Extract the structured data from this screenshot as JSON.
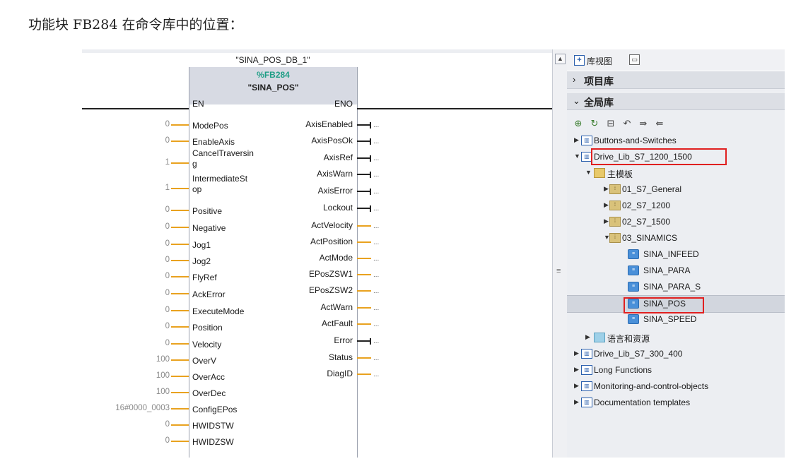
{
  "page_title": "功能块 FB284 在命令库中的位置：",
  "fb": {
    "db_name": "\"SINA_POS_DB_1\"",
    "number": "%FB284",
    "title": "\"SINA_POS\"",
    "inputs": [
      {
        "label": "EN",
        "value": ""
      },
      {
        "label": "ModePos",
        "value": "0"
      },
      {
        "label": "EnableAxis",
        "value": "0"
      },
      {
        "label": "CancelTraversin",
        "label2": "g",
        "value": "1"
      },
      {
        "label": "IntermediateSt",
        "label2": "op",
        "value": "1"
      },
      {
        "label": "Positive",
        "value": "0"
      },
      {
        "label": "Negative",
        "value": "0"
      },
      {
        "label": "Jog1",
        "value": "0"
      },
      {
        "label": "Jog2",
        "value": "0"
      },
      {
        "label": "FlyRef",
        "value": "0"
      },
      {
        "label": "AckError",
        "value": "0"
      },
      {
        "label": "ExecuteMode",
        "value": "0"
      },
      {
        "label": "Position",
        "value": "0"
      },
      {
        "label": "Velocity",
        "value": "0"
      },
      {
        "label": "OverV",
        "value": "100"
      },
      {
        "label": "OverAcc",
        "value": "100"
      },
      {
        "label": "OverDec",
        "value": "100"
      },
      {
        "label": "ConfigEPos",
        "value": "16#0000_0003"
      },
      {
        "label": "HWIDSTW",
        "value": "0"
      },
      {
        "label": "HWIDZSW",
        "value": "0"
      }
    ],
    "outputs": [
      {
        "label": "ENO",
        "kind": "rail"
      },
      {
        "label": "AxisEnabled",
        "kind": "bool"
      },
      {
        "label": "AxisPosOk",
        "kind": "bool"
      },
      {
        "label": "AxisRef",
        "kind": "bool"
      },
      {
        "label": "AxisWarn",
        "kind": "bool"
      },
      {
        "label": "AxisError",
        "kind": "bool"
      },
      {
        "label": "Lockout",
        "kind": "bool"
      },
      {
        "label": "ActVelocity",
        "kind": "word"
      },
      {
        "label": "ActPosition",
        "kind": "word"
      },
      {
        "label": "ActMode",
        "kind": "word"
      },
      {
        "label": "EPosZSW1",
        "kind": "word"
      },
      {
        "label": "EPosZSW2",
        "kind": "word"
      },
      {
        "label": "ActWarn",
        "kind": "word"
      },
      {
        "label": "ActFault",
        "kind": "word"
      },
      {
        "label": "Error",
        "kind": "bool"
      },
      {
        "label": "Status",
        "kind": "word"
      },
      {
        "label": "DiagID",
        "kind": "word"
      }
    ],
    "output_dots": "..."
  },
  "library": {
    "view_label": "库视图",
    "project_lib": "项目库",
    "global_lib": "全局库",
    "toolbar_icons": [
      "open-library-icon",
      "update-icon",
      "save-icon",
      "close-library-icon",
      "export-icon",
      "import-icon"
    ],
    "tree": [
      {
        "label": "Buttons-and-Switches",
        "level": 0,
        "icon": "book",
        "expanded": false
      },
      {
        "label": "Drive_Lib_S7_1200_1500",
        "level": 0,
        "icon": "book",
        "expanded": true
      },
      {
        "label": "主模板",
        "level": 1,
        "icon": "folder",
        "expanded": true
      },
      {
        "label": "01_S7_General",
        "level": 2,
        "icon": "type",
        "expanded": false
      },
      {
        "label": "02_S7_1200",
        "level": 2,
        "icon": "type",
        "expanded": false
      },
      {
        "label": "02_S7_1500",
        "level": 2,
        "icon": "type",
        "expanded": false
      },
      {
        "label": "03_SINAMICS",
        "level": 2,
        "icon": "type",
        "expanded": true
      },
      {
        "label": "SINA_INFEED",
        "level": 3,
        "icon": "fb",
        "expanded": null
      },
      {
        "label": "SINA_PARA",
        "level": 3,
        "icon": "fb",
        "expanded": null
      },
      {
        "label": "SINA_PARA_S",
        "level": 3,
        "icon": "fb",
        "expanded": null
      },
      {
        "label": "SINA_POS",
        "level": 3,
        "icon": "fb",
        "expanded": null,
        "selected": true
      },
      {
        "label": "SINA_SPEED",
        "level": 3,
        "icon": "fb",
        "expanded": null
      },
      {
        "label": "语言和资源",
        "level": 1,
        "icon": "lang",
        "expanded": false
      },
      {
        "label": "Drive_Lib_S7_300_400",
        "level": 0,
        "icon": "book",
        "expanded": false
      },
      {
        "label": "Long Functions",
        "level": 0,
        "icon": "book",
        "expanded": false
      },
      {
        "label": "Monitoring-and-control-objects",
        "level": 0,
        "icon": "book",
        "expanded": false
      },
      {
        "label": "Documentation templates",
        "level": 0,
        "icon": "book",
        "expanded": false
      }
    ]
  },
  "colors": {
    "fb_number": "#1f9e86",
    "word_wire": "#e9a21f",
    "highlight": "#e02020",
    "header_bg": "#d7dae3"
  }
}
